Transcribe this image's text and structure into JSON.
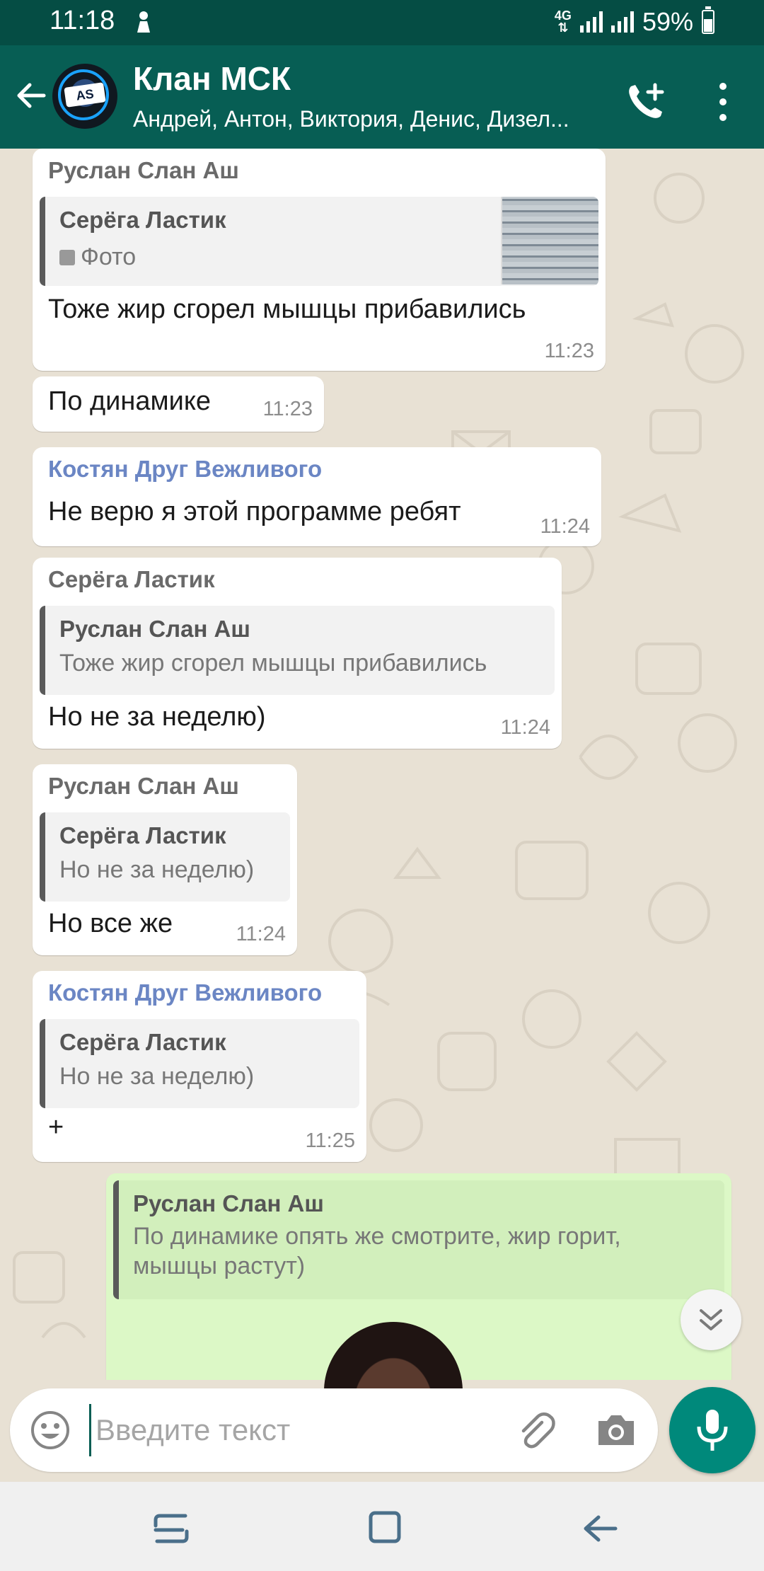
{
  "status_bar": {
    "time": "11:18",
    "network": "4G",
    "battery": "59%",
    "battery_level": 0.59
  },
  "header": {
    "title": "Клан МСК",
    "subtitle": "Андрей, Антон, Виктория, Денис, Дизел...",
    "avatar_text": "AS"
  },
  "messages": [
    {
      "sender": "Руслан Слан Аш",
      "quote_name": "Серёга Ластик",
      "quote_text": "Фото",
      "text": "Тоже жир сгорел мышцы прибавились",
      "time": "11:23"
    },
    {
      "text": "По динамике",
      "time": "11:23"
    },
    {
      "sender": "Костян Друг Вежливого",
      "text": "Не верю я этой программе ребят",
      "time": "11:24"
    },
    {
      "sender": "Серёга Ластик",
      "quote_name": "Руслан Слан Аш",
      "quote_text": "Тоже жир сгорел мышцы прибавились",
      "text": "Но не за неделю)",
      "time": "11:24"
    },
    {
      "sender": "Руслан Слан Аш",
      "quote_name": "Серёга Ластик",
      "quote_text": "Но не за неделю)",
      "text": "Но все же",
      "time": "11:24"
    },
    {
      "sender": "Костян Друг Вежливого",
      "quote_name": "Серёга Ластик",
      "quote_text": "Но не за неделю)",
      "text": "+",
      "time": "11:25"
    },
    {
      "quote_name": "Руслан Слан Аш",
      "quote_text": "По динамике опять же смотрите, жир горит, мышцы растут)"
    }
  ],
  "input": {
    "placeholder": "Введите текст"
  },
  "colors": {
    "header": "#075e54",
    "status_bar": "#054d44",
    "accent": "#00897b",
    "outgoing_bubble": "#dcf8c6"
  }
}
